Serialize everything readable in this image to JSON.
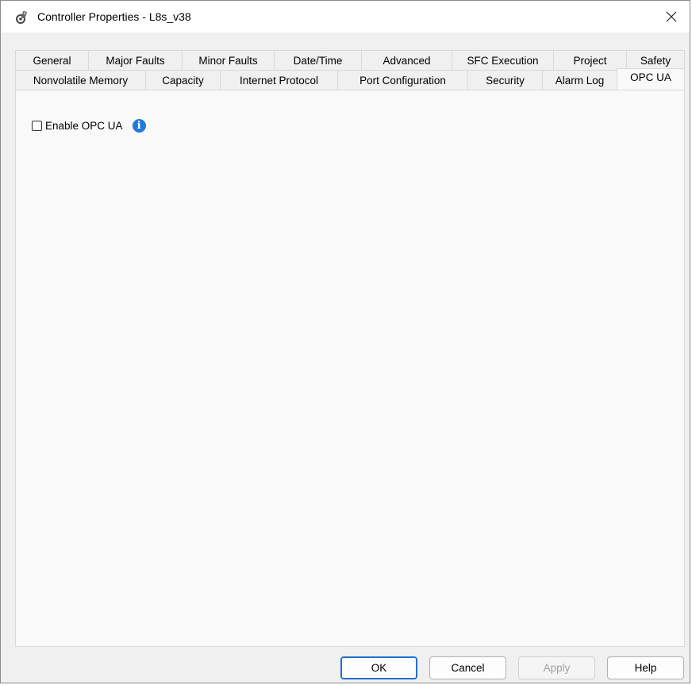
{
  "window": {
    "title": "Controller Properties - L8s_v38",
    "icon": "controller-gear-icon",
    "close_glyph": "✕"
  },
  "tabs": {
    "row1": [
      {
        "label": "General"
      },
      {
        "label": "Major Faults"
      },
      {
        "label": "Minor Faults"
      },
      {
        "label": "Date/Time"
      },
      {
        "label": "Advanced"
      },
      {
        "label": "SFC Execution"
      },
      {
        "label": "Project"
      },
      {
        "label": "Safety"
      }
    ],
    "row2": [
      {
        "label": "Nonvolatile Memory"
      },
      {
        "label": "Capacity"
      },
      {
        "label": "Internet Protocol"
      },
      {
        "label": "Port Configuration"
      },
      {
        "label": "Security"
      },
      {
        "label": "Alarm Log"
      },
      {
        "label": "OPC UA",
        "active": true
      }
    ]
  },
  "panel": {
    "enable_opcua_label": "Enable OPC UA",
    "enable_opcua_checked": false,
    "info_glyph": "i"
  },
  "buttons": {
    "ok": "OK",
    "cancel": "Cancel",
    "apply": "Apply",
    "help": "Help"
  },
  "colors": {
    "info_icon": "#1e7bd8",
    "primary_border": "#1f6fd1"
  }
}
